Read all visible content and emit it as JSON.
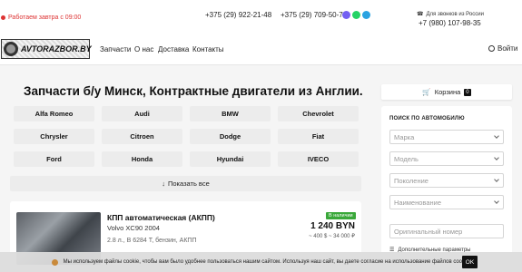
{
  "topbar": {
    "status": "Работаем завтра с 09:00",
    "phone1": "+375 (29) 922-21-48",
    "phone2": "+375 (29) 709-50-70",
    "russia_label": "Для звонков из России",
    "russia_phone": "+7 (980) 107-98-35"
  },
  "nav": {
    "logo_text": "AVTORAZBOR.BY",
    "links": [
      "Запчасти",
      "О нас",
      "Доставка",
      "Контакты"
    ],
    "login": "Войти"
  },
  "main": {
    "heading": "Запчасти б/у Минск, Контрактные двигатели из Англии.",
    "brands": [
      "Alfa Romeo",
      "Audi",
      "BMW",
      "Chevrolet",
      "Chrysler",
      "Citroen",
      "Dodge",
      "Fiat",
      "Ford",
      "Honda",
      "Hyundai",
      "IVECO"
    ],
    "show_all": "Показать все"
  },
  "product": {
    "title": "КПП автоматическая (АКПП)",
    "car": "Volvo XC90 2004",
    "specs": "2.8 л., В 6284 T, бензин, АКПП",
    "badge": "В наличии",
    "price": "1 240 BYN",
    "price_rub": "~ 400 $ ~ 34 000 ₽"
  },
  "sidebar": {
    "cart_label": "Корзина",
    "cart_count": "0",
    "search_title": "ПОИСК ПО АВТОМОБИЛЮ",
    "selects": [
      "Марка",
      "Модель",
      "Поколение",
      "Наименование"
    ],
    "original_number_placeholder": "Оригинальный номер",
    "advanced": "Дополнительные параметры"
  },
  "cookie": {
    "text": "Мы используем файлы cookie, чтобы вам было удобнее пользоваться нашим сайтом. Используя наш сайт, вы даете согласие на использование файлов cookie.",
    "ok": "OK"
  },
  "colors": {
    "accent_red": "#d33333",
    "badge_green": "#3aa83a",
    "viber": "#7360f2",
    "whatsapp": "#25d366",
    "telegram": "#2aa3e1"
  },
  "icons": [
    "phone-icon",
    "viber-icon",
    "whatsapp-icon",
    "telegram-icon",
    "login-icon",
    "arrow-down-icon",
    "cart-icon",
    "chevron-down-icon",
    "filter-icon",
    "cookie-icon"
  ]
}
